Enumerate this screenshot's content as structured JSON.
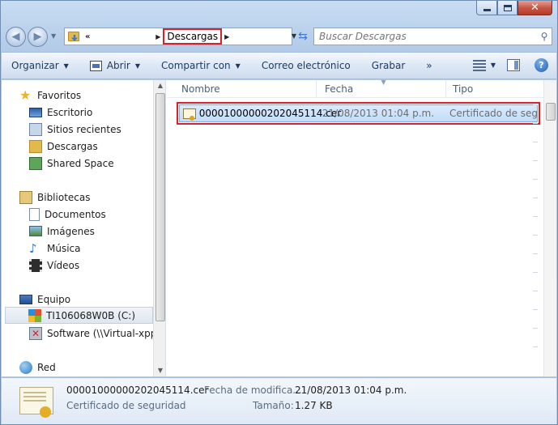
{
  "address": {
    "overflow_chevron": "«",
    "current_folder": "Descargas",
    "search_placeholder": "Buscar Descargas"
  },
  "toolbar": {
    "organize": "Organizar",
    "open": "Abrir",
    "share": "Compartir con",
    "email": "Correo electrónico",
    "burn": "Grabar",
    "more": "»"
  },
  "nav": {
    "favorites": "Favoritos",
    "desktop": "Escritorio",
    "recent": "Sitios recientes",
    "downloads": "Descargas",
    "shared_space": "Shared Space",
    "libraries": "Bibliotecas",
    "documents": "Documentos",
    "images": "Imágenes",
    "music": "Música",
    "videos": "Vídeos",
    "computer": "Equipo",
    "drive_c": "TI106068W0B (C:)",
    "network_drive": "Software (\\\\Virtual-xpp) (",
    "network": "Red"
  },
  "columns": {
    "name": "Nombre",
    "date": "Fecha",
    "type": "Tipo"
  },
  "file": {
    "name": "00001000000202045114.cer",
    "date": "21/08/2013 01:04 p.m.",
    "type": "Certificado de seg..."
  },
  "details": {
    "filename": "00001000000202045114.cer",
    "type": "Certificado de seguridad",
    "modified_label": "Fecha de modifica...",
    "modified_value": "21/08/2013 01:04 p.m.",
    "size_label": "Tamaño:",
    "size_value": "1.27 KB"
  }
}
